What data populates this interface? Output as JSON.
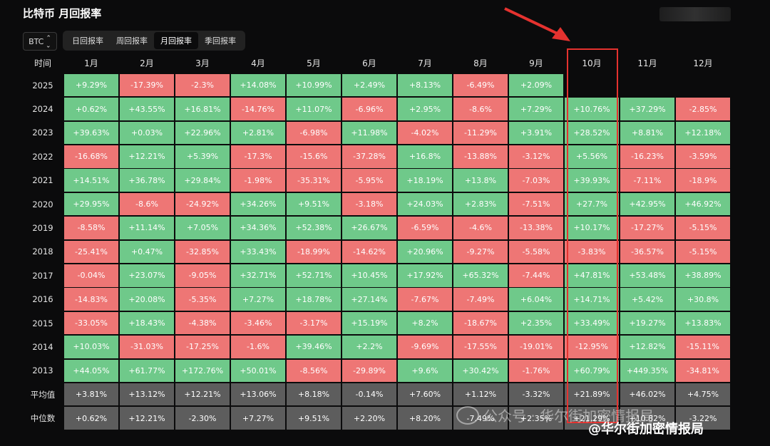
{
  "title": "比特币 月回报率",
  "asset_selector": {
    "value": "BTC",
    "icon": "up-down-chevron-icon"
  },
  "tabs": [
    {
      "label": "日回报率",
      "active": false
    },
    {
      "label": "周回报率",
      "active": false
    },
    {
      "label": "月回报率",
      "active": true
    },
    {
      "label": "季回报率",
      "active": false
    }
  ],
  "table": {
    "corner": "时间",
    "months": [
      "1月",
      "2月",
      "3月",
      "4月",
      "5月",
      "6月",
      "7月",
      "8月",
      "9月",
      "10月",
      "11月",
      "12月"
    ],
    "rows": [
      {
        "label": "2025",
        "values": [
          "+9.29%",
          "-17.39%",
          "-2.3%",
          "+14.08%",
          "+10.99%",
          "+2.49%",
          "+8.13%",
          "-6.49%",
          "+2.09%",
          "",
          "",
          ""
        ]
      },
      {
        "label": "2024",
        "values": [
          "+0.62%",
          "+43.55%",
          "+16.81%",
          "-14.76%",
          "+11.07%",
          "-6.96%",
          "+2.95%",
          "-8.6%",
          "+7.29%",
          "+10.76%",
          "+37.29%",
          "-2.85%"
        ]
      },
      {
        "label": "2023",
        "values": [
          "+39.63%",
          "+0.03%",
          "+22.96%",
          "+2.81%",
          "-6.98%",
          "+11.98%",
          "-4.02%",
          "-11.29%",
          "+3.91%",
          "+28.52%",
          "+8.81%",
          "+12.18%"
        ]
      },
      {
        "label": "2022",
        "values": [
          "-16.68%",
          "+12.21%",
          "+5.39%",
          "-17.3%",
          "-15.6%",
          "-37.28%",
          "+16.8%",
          "-13.88%",
          "-3.12%",
          "+5.56%",
          "-16.23%",
          "-3.59%"
        ]
      },
      {
        "label": "2021",
        "values": [
          "+14.51%",
          "+36.78%",
          "+29.84%",
          "-1.98%",
          "-35.31%",
          "-5.95%",
          "+18.19%",
          "+13.8%",
          "-7.03%",
          "+39.93%",
          "-7.11%",
          "-18.9%"
        ]
      },
      {
        "label": "2020",
        "values": [
          "+29.95%",
          "-8.6%",
          "-24.92%",
          "+34.26%",
          "+9.51%",
          "-3.18%",
          "+24.03%",
          "+2.83%",
          "-7.51%",
          "+27.7%",
          "+42.95%",
          "+46.92%"
        ]
      },
      {
        "label": "2019",
        "values": [
          "-8.58%",
          "+11.14%",
          "+7.05%",
          "+34.36%",
          "+52.38%",
          "+26.67%",
          "-6.59%",
          "-4.6%",
          "-13.38%",
          "+10.17%",
          "-17.27%",
          "-5.15%"
        ]
      },
      {
        "label": "2018",
        "values": [
          "-25.41%",
          "+0.47%",
          "-32.85%",
          "+33.43%",
          "-18.99%",
          "-14.62%",
          "+20.96%",
          "-9.27%",
          "-5.58%",
          "-3.83%",
          "-36.57%",
          "-5.15%"
        ]
      },
      {
        "label": "2017",
        "values": [
          "-0.04%",
          "+23.07%",
          "-9.05%",
          "+32.71%",
          "+52.71%",
          "+10.45%",
          "+17.92%",
          "+65.32%",
          "-7.44%",
          "+47.81%",
          "+53.48%",
          "+38.89%"
        ]
      },
      {
        "label": "2016",
        "values": [
          "-14.83%",
          "+20.08%",
          "-5.35%",
          "+7.27%",
          "+18.78%",
          "+27.14%",
          "-7.67%",
          "-7.49%",
          "+6.04%",
          "+14.71%",
          "+5.42%",
          "+30.8%"
        ]
      },
      {
        "label": "2015",
        "values": [
          "-33.05%",
          "+18.43%",
          "-4.38%",
          "-3.46%",
          "-3.17%",
          "+15.19%",
          "+8.2%",
          "-18.67%",
          "+2.35%",
          "+33.49%",
          "+19.27%",
          "+13.83%"
        ]
      },
      {
        "label": "2014",
        "values": [
          "+10.03%",
          "-31.03%",
          "-17.25%",
          "-1.6%",
          "+39.46%",
          "+2.2%",
          "-9.69%",
          "-17.55%",
          "-19.01%",
          "-12.95%",
          "+12.82%",
          "-15.11%"
        ]
      },
      {
        "label": "2013",
        "values": [
          "+44.05%",
          "+61.77%",
          "+172.76%",
          "+50.01%",
          "-8.56%",
          "-29.89%",
          "+9.6%",
          "+30.42%",
          "-1.76%",
          "+60.79%",
          "+449.35%",
          "-34.81%"
        ]
      }
    ],
    "stats": [
      {
        "label": "平均值",
        "values": [
          "+3.81%",
          "+13.12%",
          "+12.21%",
          "+13.06%",
          "+8.18%",
          "-0.14%",
          "+7.60%",
          "+1.12%",
          "-3.32%",
          "+21.89%",
          "+46.02%",
          "+4.75%"
        ]
      },
      {
        "label": "中位数",
        "values": [
          "+0.62%",
          "+12.21%",
          "-2.30%",
          "+7.27%",
          "+9.51%",
          "+2.20%",
          "+8.20%",
          "-7.49%",
          "+2.35%",
          "+21.29%",
          "+10.82%",
          "-3.22%"
        ]
      }
    ]
  },
  "colors": {
    "positive": "#6fc98a",
    "negative": "#ee7675",
    "stat": "#5d5d5d",
    "highlight": "#e5322f"
  },
  "watermark": {
    "text": "公众号 · 华尔街加密情报局",
    "icon": "wechat-icon"
  },
  "brand": {
    "text": "@华尔街加密情报局",
    "icon": "weibo-icon"
  }
}
